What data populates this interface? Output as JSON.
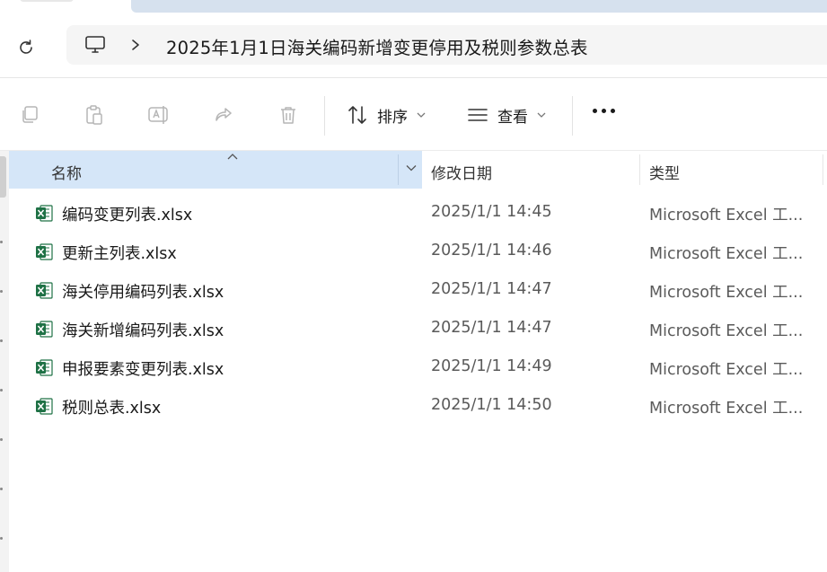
{
  "address": {
    "location_icon": "this-pc-icon",
    "path": "2025年1月1日海关编码新增变更停用及税则参数总表"
  },
  "toolbar": {
    "copy_icon": "copy-icon",
    "paste_icon": "paste-icon",
    "rename_icon": "rename-icon",
    "share_icon": "share-icon",
    "delete_icon": "delete-icon",
    "sort_label": "排序",
    "view_label": "查看",
    "more_icon": "more-icon"
  },
  "columns": {
    "name": "名称",
    "date": "修改日期",
    "type": "类型"
  },
  "files": [
    {
      "name": "编码变更列表.xlsx",
      "date": "2025/1/1 14:45",
      "type": "Microsoft Excel 工..."
    },
    {
      "name": "更新主列表.xlsx",
      "date": "2025/1/1 14:46",
      "type": "Microsoft Excel 工..."
    },
    {
      "name": "海关停用编码列表.xlsx",
      "date": "2025/1/1 14:47",
      "type": "Microsoft Excel 工..."
    },
    {
      "name": "海关新增编码列表.xlsx",
      "date": "2025/1/1 14:47",
      "type": "Microsoft Excel 工..."
    },
    {
      "name": "申报要素变更列表.xlsx",
      "date": "2025/1/1 14:49",
      "type": "Microsoft Excel 工..."
    },
    {
      "name": "税则总表.xlsx",
      "date": "2025/1/1 14:50",
      "type": "Microsoft Excel 工..."
    }
  ],
  "colors": {
    "accent": "#d5e6f8",
    "excel_green": "#1e7145"
  }
}
